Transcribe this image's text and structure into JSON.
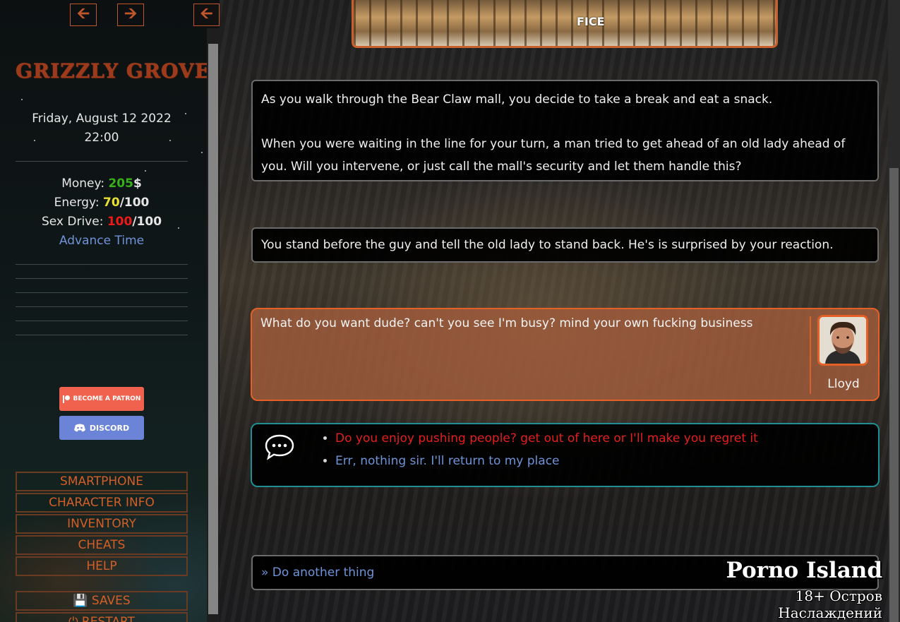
{
  "nav": {
    "back": "🡨",
    "forward": "🡪",
    "collapse": "🡨"
  },
  "sidebar": {
    "title": "GRIZZLY GROVE",
    "date": "Friday, August 12 2022",
    "time": "22:00",
    "stats": {
      "money_label": "Money: ",
      "money_value": "205",
      "money_unit": "$",
      "energy_label": "Energy: ",
      "energy_value": "70",
      "energy_max": "/100",
      "sexdrive_label": "Sex Drive: ",
      "sexdrive_value": "100",
      "sexdrive_max": "/100"
    },
    "advance_time": "Advance Time",
    "patron_label": "BECOME A PATRON",
    "discord_label": "DISCORD",
    "menu": [
      "SMARTPHONE",
      "CHARACTER INFO",
      "INVENTORY",
      "CHEATS",
      "HELP"
    ],
    "saves": "SAVES",
    "restart": "RESTART"
  },
  "main": {
    "top_image_sign": "FICE",
    "narration1_p1": "As you walk through the Bear Claw mall, you decide to take a break and eat a snack.",
    "narration1_p2": "When you were waiting in the line for your turn, a man tried to get ahead of an old lady ahead of you. Will you intervene, or just call the mall's security and let them handle this?",
    "narration2": "You stand before the guy and tell the old lady to stand back. He's is surprised by your reaction.",
    "dialogue": {
      "text": "What do you want dude? can't you see I'm busy? mind your own fucking business",
      "speaker": "Lloyd"
    },
    "choices": [
      "Do you enjoy pushing people? get out of here or I'll make you regret it",
      "Err, nothing sir. I'll return to my place"
    ],
    "another_thing": "» Do another thing"
  },
  "watermark": {
    "line1": "Porno Island",
    "line2": "18+ Остров Наслаждений"
  },
  "colors": {
    "accent": "#c0562b",
    "money": "#37b11a",
    "energy": "#e8e031",
    "sexdrive": "#ee1a1a",
    "link": "#6f93d9",
    "dialogue_border": "#e36126",
    "choice_border": "#1f8f93"
  }
}
